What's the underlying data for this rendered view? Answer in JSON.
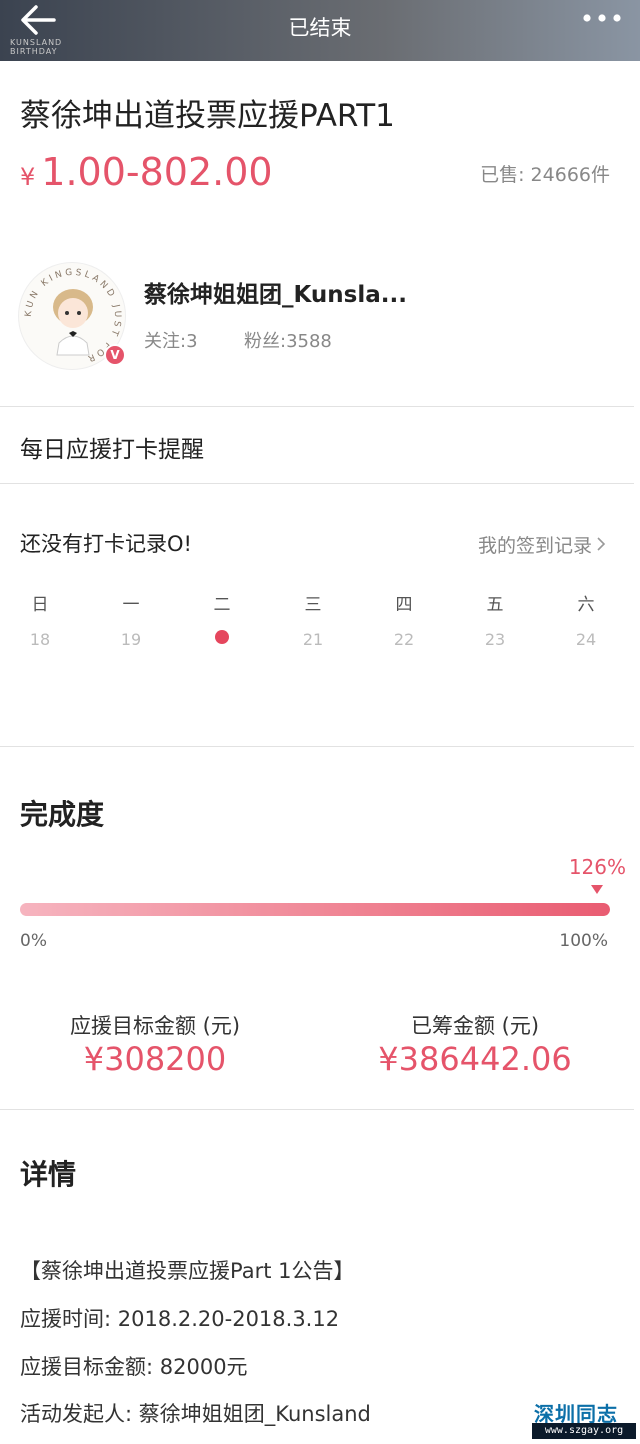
{
  "header": {
    "title": "已结束",
    "watermark_lines": [
      "KUNSLAND",
      "BIRTHDAY"
    ]
  },
  "product": {
    "title": "蔡徐坤出道投票应援PART1",
    "price_symbol": "¥",
    "price_range": "1.00-802.00",
    "sold": "已售: 24666件"
  },
  "shop": {
    "name": "蔡徐坤姐姐团_Kunsla...",
    "follow": "关注:3",
    "fans": "粉丝:3588",
    "avatar_text": "KUN KINGSLAND JUST FOR",
    "verified": "V"
  },
  "checkin": {
    "reminder_label": "每日应援打卡提醒",
    "empty_text": "还没有打卡记录O!",
    "my_record_link": "我的签到记录",
    "weekdays": [
      "日",
      "一",
      "二",
      "三",
      "四",
      "五",
      "六"
    ],
    "dates": [
      "18",
      "19",
      "",
      "21",
      "22",
      "23",
      "24"
    ],
    "today_index": 2
  },
  "progress": {
    "section_title": "完成度",
    "percent_label": "126%",
    "percent_value": 126,
    "min_label": "0%",
    "max_label": "100%"
  },
  "funding": {
    "target_label": "应援目标金额 (元)",
    "target_value": "¥308200",
    "raised_label": "已筹金额 (元)",
    "raised_value": "¥386442.06"
  },
  "details": {
    "section_title": "详情",
    "lines": [
      "【蔡徐坤出道投票应援Part 1公告】",
      "应援时间: 2018.2.20-2018.3.12",
      "应援目标金额: 82000元",
      "活动发起人: 蔡徐坤姐姐团_Kunsland"
    ]
  },
  "watermark": {
    "site_name": "深圳同志",
    "site_url": "www.szgay.org"
  },
  "colors": {
    "accent": "#e5546a",
    "progress_light": "#f6b4bf",
    "progress_dark": "#e95c72",
    "watermark_blue": "#0b6fa8"
  }
}
